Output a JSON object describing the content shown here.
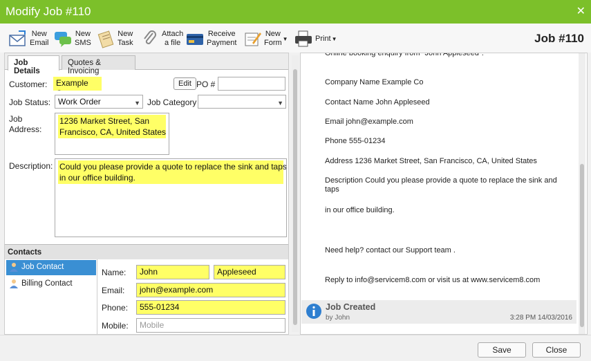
{
  "window": {
    "title": "Modify Job #110"
  },
  "toolbar": {
    "items": [
      {
        "label": "New\nEmail",
        "icon": "email-icon"
      },
      {
        "label": "New\nSMS",
        "icon": "sms-icon"
      },
      {
        "label": "New\nTask",
        "icon": "task-icon"
      },
      {
        "label": "Attach\na file",
        "icon": "paperclip-icon"
      },
      {
        "label": "Receive\nPayment",
        "icon": "payment-icon"
      },
      {
        "label": "New\nForm",
        "icon": "form-icon"
      },
      {
        "label": "Print",
        "icon": "printer-icon"
      }
    ],
    "job_number": "Job #110"
  },
  "tabs": [
    {
      "label": "Job Details",
      "active": true
    },
    {
      "label": "Quotes & Invoicing",
      "active": false
    }
  ],
  "job": {
    "customer_label": "Customer:",
    "customer_value": "Example Co",
    "edit_label": "Edit",
    "po_label": "PO #",
    "po_value": "",
    "status_label": "Job Status:",
    "status_value": "Work Order",
    "category_label": "Job Category",
    "category_value": "",
    "address_label": "Job\nAddress:",
    "address_value": "1236 Market Street, San\nFrancisco, CA, United States",
    "description_label": "Description:",
    "description_value": "Could you please provide a quote to replace the sink and taps\nin our office building."
  },
  "contacts": {
    "header": "Contacts",
    "list": [
      {
        "label": "Job Contact",
        "active": true
      },
      {
        "label": "Billing Contact",
        "active": false
      }
    ],
    "name_label": "Name:",
    "first_name": "John",
    "last_name": "Appleseed",
    "email_label": "Email:",
    "email_value": "john@example.com",
    "phone_label": "Phone:",
    "phone_value": "555-01234",
    "mobile_label": "Mobile:",
    "mobile_placeholder": "Mobile"
  },
  "email_preview": {
    "lines": [
      "Online booking enquiry from \"John Appleseed\".",
      "Company Name Example Co",
      "Contact Name John Appleseed",
      "Email john@example.com",
      "Phone 555-01234",
      "Address 1236 Market Street, San Francisco, CA, United States",
      "Description Could you please provide a quote to replace the sink and taps",
      "in our office building.",
      "Need help? contact our Support team .",
      "Reply to info@servicem8.com or visit us at www.servicem8.com"
    ]
  },
  "activity": {
    "title": "Job Created",
    "by": "by John",
    "timestamp": "3:28 PM 14/03/2016"
  },
  "footer": {
    "save_label": "Save",
    "close_label": "Close"
  },
  "colors": {
    "titlebar": "#7cc02a",
    "highlight": "#ffff66",
    "selection": "#3a8fd3"
  }
}
